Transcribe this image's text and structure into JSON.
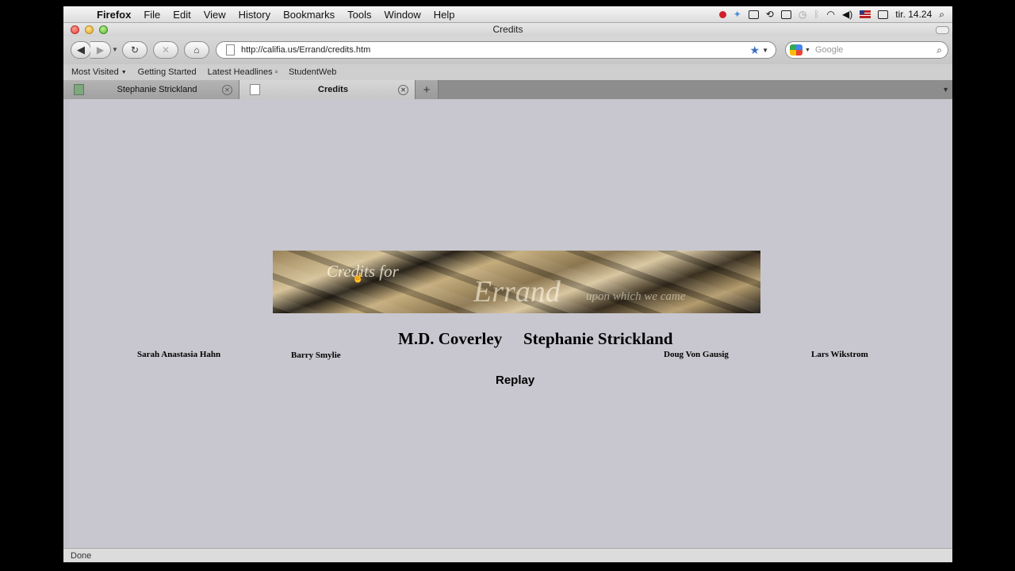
{
  "menubar": {
    "app": "Firefox",
    "items": [
      "File",
      "Edit",
      "View",
      "History",
      "Bookmarks",
      "Tools",
      "Window",
      "Help"
    ],
    "clock": "tir. 14.24"
  },
  "window": {
    "title": "Credits"
  },
  "navbar": {
    "url": "http://califia.us/Errand/credits.htm",
    "search_placeholder": "Google"
  },
  "bookmarks": [
    "Most Visited",
    "Getting Started",
    "Latest Headlines",
    "StudentWeb"
  ],
  "tabs": [
    {
      "label": "Stephanie Strickland",
      "active": false
    },
    {
      "label": "Credits",
      "active": true
    }
  ],
  "page": {
    "banner": {
      "line1": "Credits for",
      "title": "Errand",
      "subtitle": "upon which we came"
    },
    "main_names": [
      "M.D. Coverley",
      "Stephanie Strickland"
    ],
    "contributors": [
      "Sarah Anastasia Hahn",
      "Barry Smylie",
      "Doug Von Gausig",
      "Lars Wikstrom"
    ],
    "replay": "Replay"
  },
  "status": "Done"
}
